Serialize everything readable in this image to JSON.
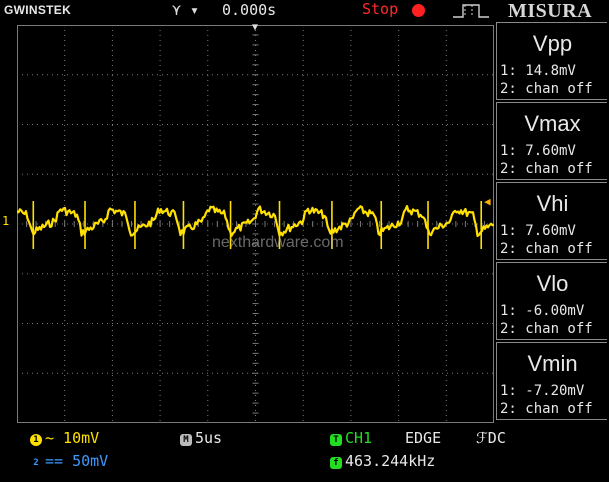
{
  "topbar": {
    "brand": "GWINSTEK",
    "trigger_icon": "trigger-arrows-icon",
    "time_offset": "0.000s",
    "run_state": "Stop",
    "edge_icon": "rising-edge-icon",
    "overlay_brand": "MISURA"
  },
  "watermark": "nexthardware.com",
  "channel_marker": "1",
  "measurements": [
    {
      "name": "Vpp",
      "ch1": "1: 14.8mV",
      "ch2": "2: chan off"
    },
    {
      "name": "Vmax",
      "ch1": "1: 7.60mV",
      "ch2": "2: chan off"
    },
    {
      "name": "Vhi",
      "ch1": "1: 7.60mV",
      "ch2": "2: chan off"
    },
    {
      "name": "Vlo",
      "ch1": "1: -6.00mV",
      "ch2": "2: chan off"
    },
    {
      "name": "Vmin",
      "ch1": "1: -7.20mV",
      "ch2": "2: chan off"
    }
  ],
  "bottom": {
    "ch1_badge": "1",
    "ch1_scale": "~ 10mV",
    "ch2_badge": "2",
    "ch2_scale": "== 50mV",
    "timebase_badge": "M",
    "timebase": "5us",
    "trigger_badge": "T",
    "trigger_source": "CH1",
    "trigger_type": "EDGE",
    "trigger_coupling": "ℱDC",
    "freq_badge": "f",
    "frequency": "463.244kHz"
  },
  "colors": {
    "ch1_trace": "#ffe000",
    "ch2": "#3a9bff",
    "trigger": "#22dd22",
    "stop": "#ff2a2a",
    "grid": "#7a7a7a"
  }
}
